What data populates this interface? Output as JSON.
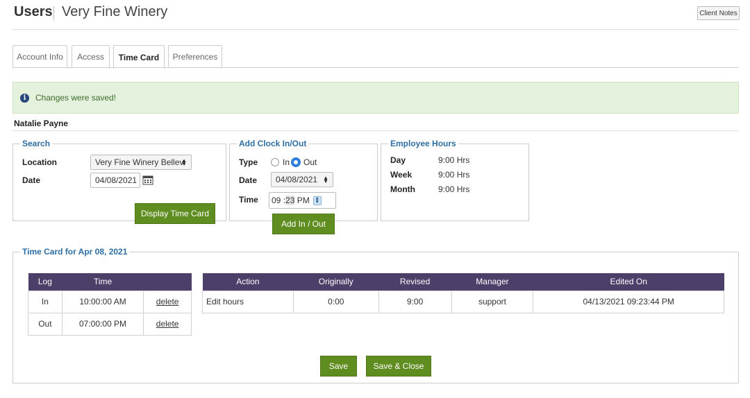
{
  "header": {
    "title": "Users",
    "subtitle": "Very Fine Winery",
    "client_notes_label": "Client Notes"
  },
  "tabs": [
    {
      "label": "Account Info",
      "active": false
    },
    {
      "label": "Access",
      "active": false
    },
    {
      "label": "Time Card",
      "active": true
    },
    {
      "label": "Preferences",
      "active": false
    }
  ],
  "alert": {
    "message": "Changes were saved!",
    "icon": "info-icon",
    "color": "#e3f1dd"
  },
  "employee": {
    "name": "Natalie Payne"
  },
  "search": {
    "legend": "Search",
    "location_label": "Location",
    "location_value": "Very Fine Winery Bellev",
    "date_label": "Date",
    "date_value": "04/08/2021",
    "button_label": "Display Time Card"
  },
  "clock": {
    "legend": "Add Clock In/Out",
    "type_label": "Type",
    "in_label": "In",
    "out_label": "Out",
    "selected": "Out",
    "date_label": "Date",
    "date_value": "04/08/2021",
    "time_label": "Time",
    "hour": "09",
    "minute": "23",
    "ampm": "PM",
    "button_label": "Add In / Out"
  },
  "hours": {
    "legend": "Employee Hours",
    "rows": [
      {
        "label": "Day",
        "value": "9:00 Hrs"
      },
      {
        "label": "Week",
        "value": "9:00 Hrs"
      },
      {
        "label": "Month",
        "value": "9:00 Hrs"
      }
    ]
  },
  "timecard": {
    "legend": "Time Card for Apr 08, 2021",
    "log_headers": [
      "Log",
      "Time",
      ""
    ],
    "log_rows": [
      {
        "log": "In",
        "time": "10:00:00 AM",
        "action": "delete"
      },
      {
        "log": "Out",
        "time": "07:00:00 PM",
        "action": "delete"
      }
    ],
    "action_headers": [
      "Action",
      "Originally",
      "Revised",
      "Manager",
      "Edited On"
    ],
    "action_rows": [
      {
        "action": "Edit hours",
        "originally": "0:00",
        "revised": "9:00",
        "manager": "support",
        "edited_on": "04/13/2021 09:23:44 PM"
      }
    ]
  },
  "footer": {
    "save_label": "Save",
    "save_close_label": "Save & Close"
  },
  "colors": {
    "accent_green": "#5f8d1f",
    "table_header": "#4c3f69",
    "legend_blue": "#2d6ea3"
  }
}
